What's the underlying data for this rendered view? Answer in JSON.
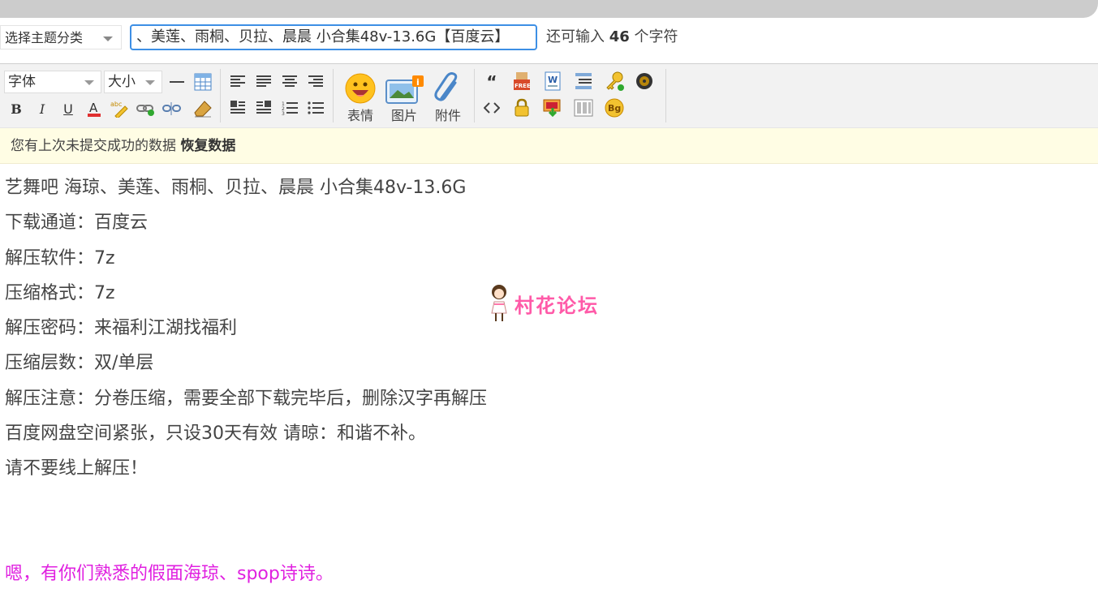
{
  "topic_select": {
    "label": "选择主题分类"
  },
  "title_input": {
    "value": "、美莲、雨桐、贝拉、晨晨 小合集48v-13.6G【百度云】"
  },
  "counter": {
    "prefix": "还可输入",
    "count": "46",
    "suffix": "个字符"
  },
  "toolbar": {
    "font_label": "字体",
    "size_label": "大小",
    "emoji_label": "表情",
    "image_label": "图片",
    "attach_label": "附件"
  },
  "restore_bar": {
    "message": "您有上次未提交成功的数据",
    "action": "恢复数据"
  },
  "content": {
    "lines": [
      "艺舞吧 海琼、美莲、雨桐、贝拉、晨晨 小合集48v-13.6G",
      "下载通道：百度云",
      "解压软件：7z",
      "压缩格式：7z",
      "解压密码：来福利江湖找福利",
      "压缩层数：双/单层",
      "解压注意：分卷压缩，需要全部下载完毕后，删除汉字再解压",
      "百度网盘空间紧张，只设30天有效   请晾：和谐不补。",
      "请不要线上解压！"
    ],
    "pink_line": "嗯，有你们熟悉的假面海琼、spop诗诗。",
    "pink_color": "#e020e0"
  },
  "watermark": {
    "text": "村花论坛",
    "color": "#ff5aa8"
  },
  "colors": {
    "input_border": "#3d8fe5",
    "restore_bg": "#fffde4",
    "toolbar_bg": "#f2f2f2"
  }
}
